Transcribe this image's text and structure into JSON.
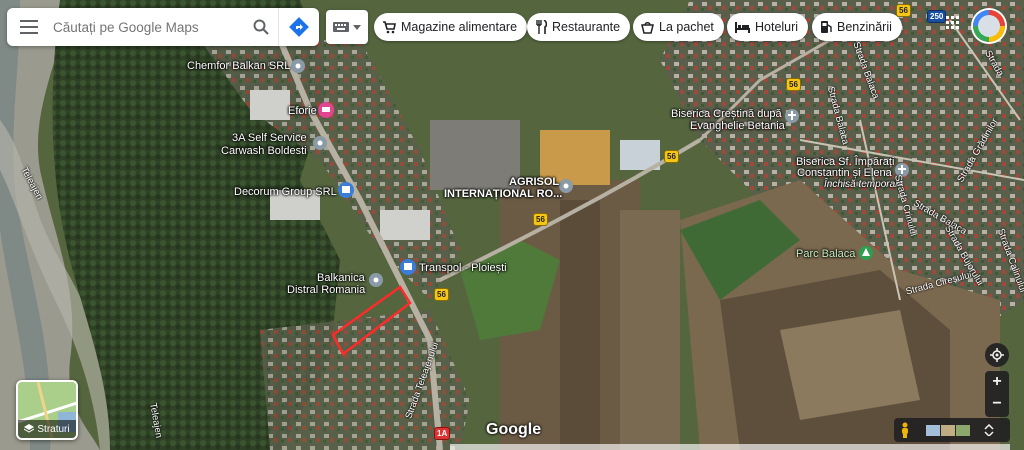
{
  "search": {
    "placeholder": "Căutați pe Google Maps"
  },
  "chips": [
    {
      "label": "Magazine alimentare"
    },
    {
      "label": "Restaurante"
    },
    {
      "label": "La pachet"
    },
    {
      "label": "Hoteluri"
    },
    {
      "label": "Benzinării"
    }
  ],
  "places": [
    {
      "name": "Chemfor Balkan SRL"
    },
    {
      "name": "Eforie"
    },
    {
      "name": "3A Self Service"
    },
    {
      "name": "Carwash Boldesti"
    },
    {
      "name": "Decorum Group SRL"
    },
    {
      "name": "AGRISOL"
    },
    {
      "name": "INTERNAȚIONAL RO..."
    },
    {
      "name": "Transpol - Ploiești"
    },
    {
      "name": "Balkanica"
    },
    {
      "name": "Distral Romania"
    },
    {
      "name": "Biserica Creștină după"
    },
    {
      "name": "Evanghelie Betania"
    },
    {
      "name": "Biserica Sf. Împărați"
    },
    {
      "name": "Constantin și Elena"
    },
    {
      "name": "Închisă temporar"
    },
    {
      "name": "Parc Balaca"
    }
  ],
  "streets": [
    {
      "name": "Teleajen"
    },
    {
      "name": "Teleajen"
    },
    {
      "name": "Strada Teleajenului"
    },
    {
      "name": "Strada Balaca"
    },
    {
      "name": "Strada Balaca"
    },
    {
      "name": "Strada Balaca"
    },
    {
      "name": "Strada Crinului"
    },
    {
      "name": "Strada Cireșului"
    },
    {
      "name": "Strada Grădinilor"
    },
    {
      "name": "Strada Bujorului"
    },
    {
      "name": "Strada Calinului"
    },
    {
      "name": "Strada"
    }
  ],
  "shields": {
    "road56": "56",
    "road1a": "1A",
    "road250": "250"
  },
  "layers": {
    "label": "Straturi"
  },
  "logo": "Google",
  "colors": {
    "selection": "#ff2a2a",
    "pin_grey": "#8a9aa6",
    "pin_blue": "#3b7dd8",
    "pin_pink": "#e2458f",
    "pin_green": "#2e9e4f",
    "directions": "#1a73e8"
  }
}
